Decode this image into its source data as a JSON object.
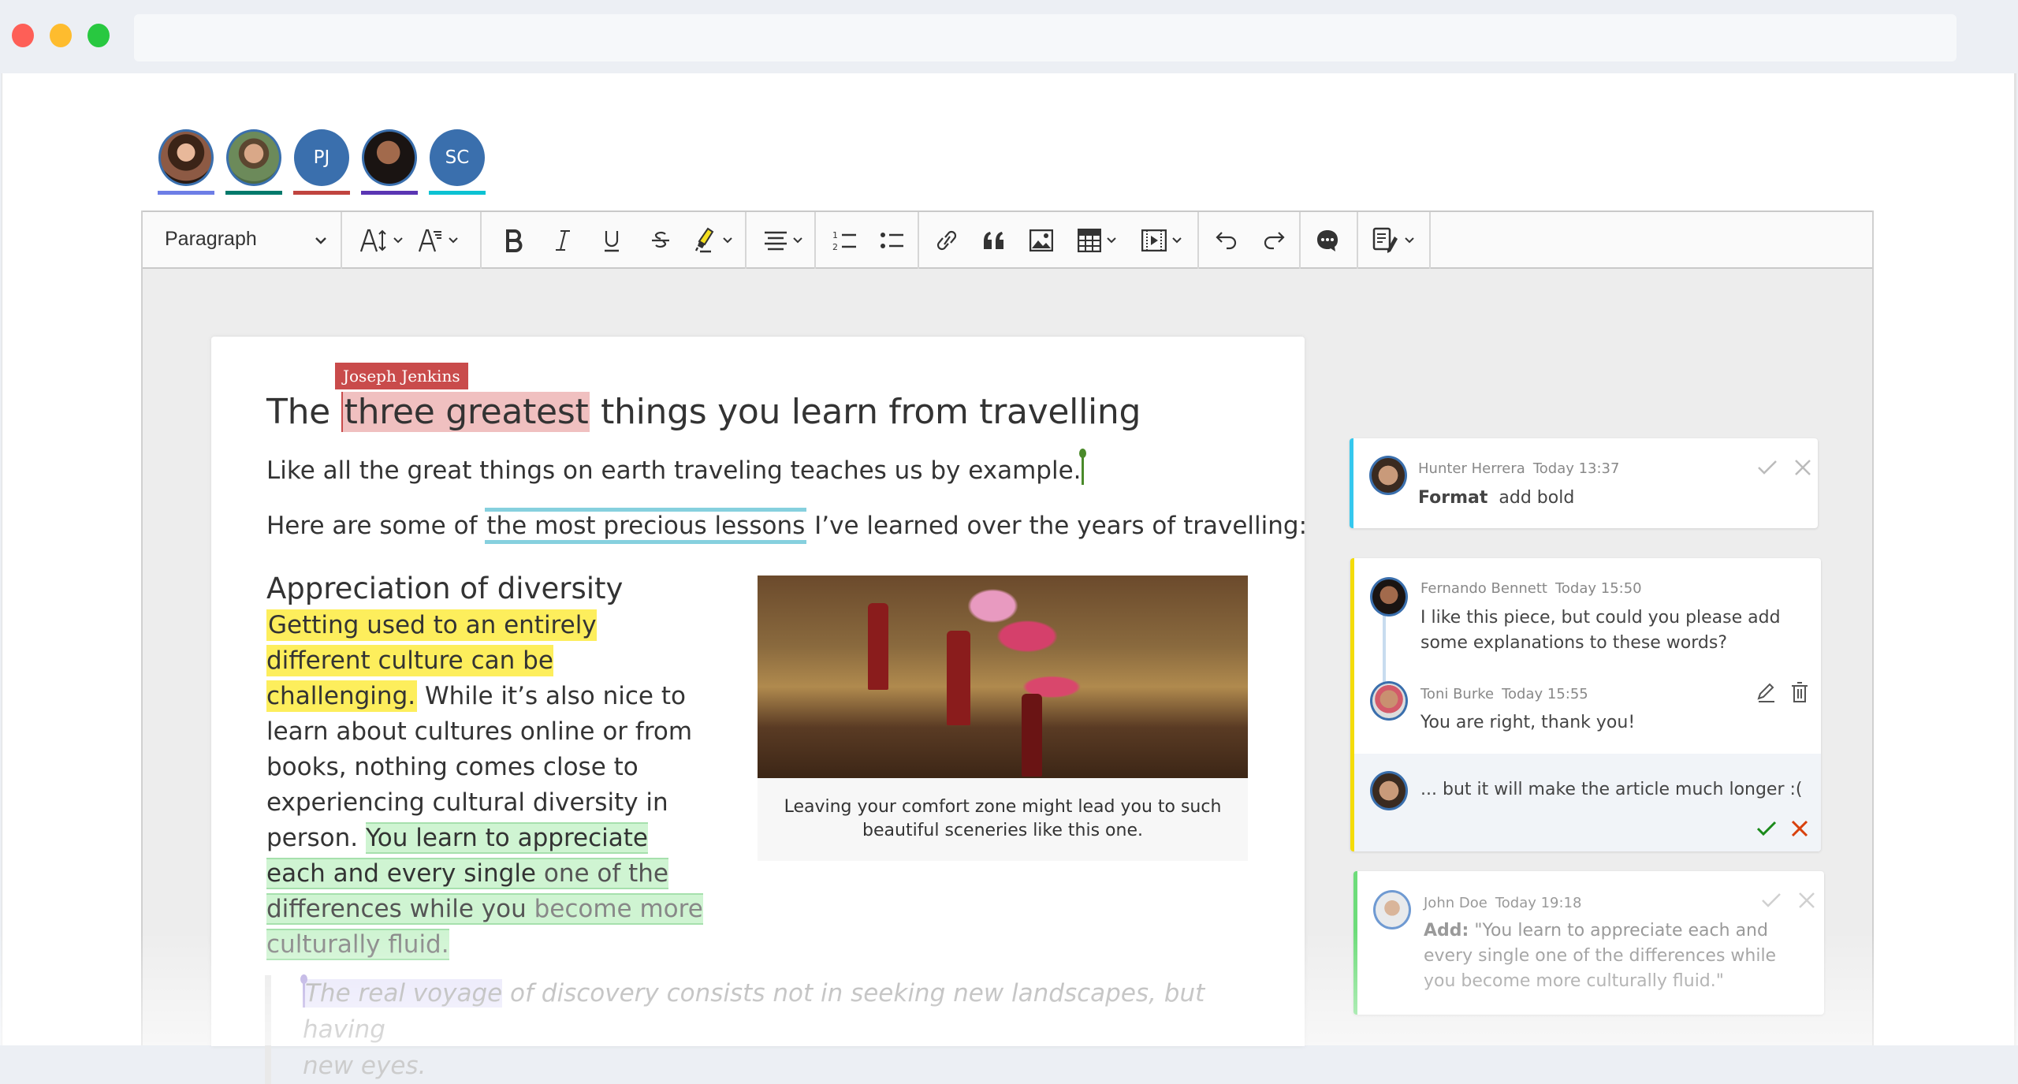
{
  "window": {
    "traffic_lights": [
      "close",
      "minimize",
      "maximize"
    ],
    "url": ""
  },
  "collaborators": [
    {
      "name": "user-1",
      "initials": "",
      "photo": true,
      "color": "#6d7ee6"
    },
    {
      "name": "user-2",
      "initials": "",
      "photo": true,
      "color": "#00796b"
    },
    {
      "name": "user-3",
      "initials": "PJ",
      "photo": false,
      "color": "#c0443f"
    },
    {
      "name": "user-4",
      "initials": "",
      "photo": true,
      "color": "#5a35b3"
    },
    {
      "name": "user-5",
      "initials": "SC",
      "photo": false,
      "color": "#0cc2d3"
    }
  ],
  "toolbar": {
    "heading_select": "Paragraph",
    "buttons": [
      {
        "id": "font-size",
        "icon": "font-size-icon",
        "dropdown": true
      },
      {
        "id": "font-family",
        "icon": "font-family-icon",
        "dropdown": true
      },
      {
        "id": "bold",
        "icon": "bold-icon"
      },
      {
        "id": "italic",
        "icon": "italic-icon"
      },
      {
        "id": "underline",
        "icon": "underline-icon"
      },
      {
        "id": "strikethrough",
        "icon": "strikethrough-icon"
      },
      {
        "id": "highlight",
        "icon": "highlighter-icon",
        "dropdown": true
      },
      {
        "id": "alignment",
        "icon": "align-center-icon",
        "dropdown": true
      },
      {
        "id": "numbered-list",
        "icon": "numbered-list-icon"
      },
      {
        "id": "bulleted-list",
        "icon": "bulleted-list-icon"
      },
      {
        "id": "link",
        "icon": "link-icon"
      },
      {
        "id": "block-quote",
        "icon": "quote-icon"
      },
      {
        "id": "insert-image",
        "icon": "image-icon"
      },
      {
        "id": "insert-table",
        "icon": "table-icon",
        "dropdown": true
      },
      {
        "id": "insert-media",
        "icon": "media-icon",
        "dropdown": true
      },
      {
        "id": "undo",
        "icon": "undo-icon"
      },
      {
        "id": "redo",
        "icon": "redo-icon"
      },
      {
        "id": "comment",
        "icon": "comment-icon"
      },
      {
        "id": "track-changes",
        "icon": "track-changes-icon",
        "dropdown": true
      }
    ]
  },
  "document": {
    "title_pre": "The ",
    "title_marked": "three greatest",
    "title_post": " things you learn from travelling",
    "marker_user": "Joseph Jenkins",
    "p1": "Like all the great things on earth traveling teaches us by example.",
    "p2_pre": "Here are some of ",
    "p2_marked": "the most precious lessons",
    "p2_post": " I’ve learned over the years of travelling:",
    "h2": "Appreciation of diversity",
    "para_yellow": "Getting used to an entirely different culture can be challenging.",
    "para_plain": " While it’s also nice to learn about cultures online or from books, nothing comes close to experiencing cultural diversity in person. ",
    "para_green_1": "You learn to appreciate each and every single",
    "para_green_2": " one of the differences while you",
    "para_green_3": " become more culturally fluid.",
    "figure_caption": "Leaving your comfort zone might lead you to such beautiful sceneries like this one.",
    "quote_marked": "The real voyage",
    "quote_rest": " of discovery consists not in seeking new landscapes, but having",
    "quote_last": "new eyes."
  },
  "comments": [
    {
      "accent": "#35c8ee",
      "author": "Hunter Herrera",
      "time": "Today 13:37",
      "label": "Format",
      "text": "add bold"
    },
    {
      "accent": "#f4dc0a",
      "thread": [
        {
          "author": "Fernando Bennett",
          "time": "Today 15:50",
          "text": "I like this piece, but could you please add some explanations to these words?"
        },
        {
          "author": "Toni Burke",
          "time": "Today 15:55",
          "text": "You are right, thank you!"
        }
      ],
      "reply_draft": "... but it will make the article much longer :("
    },
    {
      "accent": "#6ddc7a",
      "author": "John Doe",
      "time": "Today 19:18",
      "label": "Add:",
      "text": "\"You learn to appreciate each and every single one of the differences while you become more culturally fluid.\""
    }
  ]
}
